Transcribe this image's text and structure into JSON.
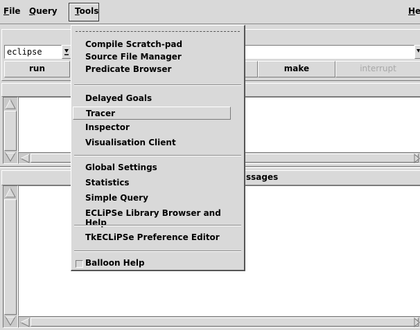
{
  "menubar": {
    "file": "ile",
    "file_mnemonic": "F",
    "query": "uery",
    "query_mnemonic": "Q",
    "tools": "ools",
    "tools_mnemonic": "T",
    "help": "el",
    "help_mnemonic": "H"
  },
  "toolbar": {
    "module_value": "eclipse",
    "query_value": "",
    "run_label": "run",
    "make_label": "make",
    "interrupt_label": "interrupt"
  },
  "messages_label": "ssages",
  "tools_menu": {
    "items": [
      {
        "label": "Compile Scratch-pad"
      },
      {
        "label": "Source File Manager"
      },
      {
        "label": "Predicate Browser"
      },
      {
        "label": "Delayed Goals"
      },
      {
        "label": "Tracer",
        "active": true
      },
      {
        "label": "Inspector"
      },
      {
        "label": "Visualisation Client"
      },
      {
        "label": "Global Settings"
      },
      {
        "label": "Statistics"
      },
      {
        "label": "Simple Query"
      },
      {
        "label": "ECLiPSe Library Browser and Help"
      },
      {
        "label": "TkECLiPSe Preference Editor"
      }
    ],
    "balloon_help": "Balloon Help",
    "balloon_help_checked": false
  },
  "colors": {
    "background": "#d9d9d9",
    "pane": "#ffffff",
    "trough": "#c9c9c9"
  },
  "icons": [
    "dropdown-arrow-icon",
    "scroll-up-arrow-icon",
    "scroll-down-arrow-icon",
    "scroll-left-arrow-icon",
    "scroll-right-arrow-icon"
  ]
}
